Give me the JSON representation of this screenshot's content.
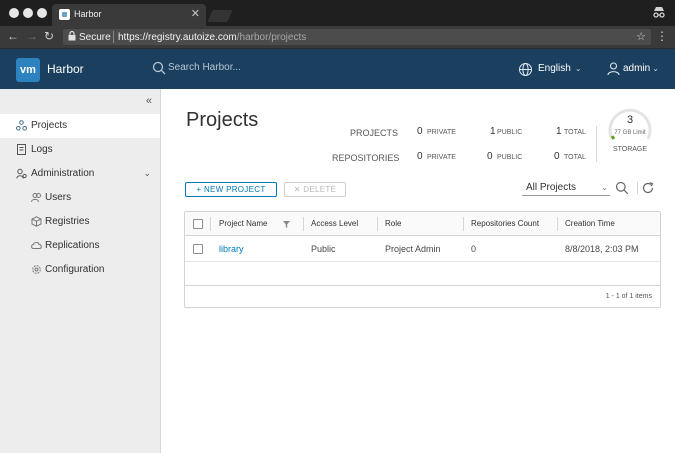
{
  "browser": {
    "tab_title": "Harbor",
    "tab_close": "✕",
    "secure_label": "Secure",
    "url_base": "https://registry.autoize.com",
    "url_path": "/harbor/projects"
  },
  "header": {
    "logo_text": "vm",
    "brand": "Harbor",
    "search_placeholder": "Search Harbor...",
    "language": "English",
    "user": "admin"
  },
  "sidebar": {
    "collapse_glyph": "«",
    "items": [
      {
        "label": "Projects"
      },
      {
        "label": "Logs"
      },
      {
        "label": "Administration",
        "caret": "⌄"
      },
      {
        "label": "Users"
      },
      {
        "label": "Registries"
      },
      {
        "label": "Replications"
      },
      {
        "label": "Configuration"
      }
    ]
  },
  "main": {
    "title": "Projects",
    "stats": {
      "projects_label": "PROJECTS",
      "repositories_label": "REPOSITORIES",
      "private_label": "PRIVATE",
      "public_label": "PUBLIC",
      "total_label": "TOTAL",
      "projects_private": "0",
      "projects_public": "1",
      "projects_total": "1",
      "repos_private": "0",
      "repos_public": "0",
      "repos_total": "0"
    },
    "storage": {
      "value": "3",
      "limit": "77 GB Limit",
      "label": "STORAGE",
      "used_fraction": 0.04
    },
    "toolbar": {
      "new_project": "+ NEW PROJECT",
      "delete": "✕ DELETE",
      "filter": "All Projects"
    },
    "table": {
      "columns": [
        "Project Name",
        "Access Level",
        "Role",
        "Repositories Count",
        "Creation Time"
      ],
      "rows": [
        {
          "name": "library",
          "access": "Public",
          "role": "Project Admin",
          "repos": "0",
          "created": "8/8/2018, 2:03 PM"
        }
      ],
      "footer": "1 - 1 of 1 items"
    }
  },
  "colors": {
    "header_bg": "#1b3f5e",
    "accent": "#0079b8",
    "gauge_green": "#62a420"
  }
}
